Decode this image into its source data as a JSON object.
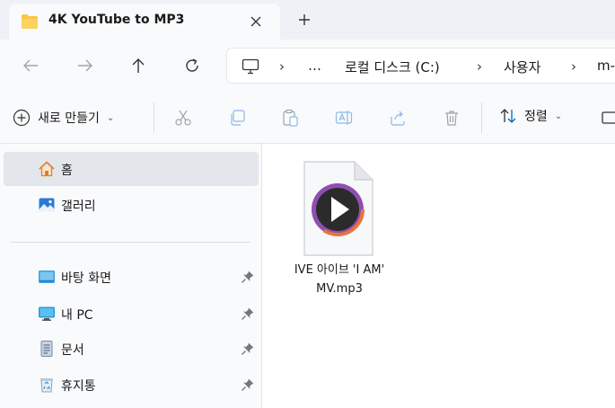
{
  "tab": {
    "title": "4K YouTube to MP3",
    "icon": "folder-icon"
  },
  "address": {
    "crumbs": [
      "…",
      "로컬 디스크 (C:)",
      "사용자",
      "m-"
    ]
  },
  "toolbar": {
    "new_label": "새로 만들기",
    "sort_label": "정렬"
  },
  "sidebar": {
    "items": [
      {
        "label": "홈",
        "icon": "home-icon",
        "selected": true
      },
      {
        "label": "갤러리",
        "icon": "gallery-icon"
      },
      {
        "label": "바탕 화면",
        "icon": "desktop-icon",
        "pinned": true
      },
      {
        "label": "내 PC",
        "icon": "pc-icon",
        "pinned": true
      },
      {
        "label": "문서",
        "icon": "document-icon",
        "pinned": true
      },
      {
        "label": "휴지통",
        "icon": "recycle-bin-icon",
        "pinned": true
      }
    ]
  },
  "files": [
    {
      "name": "IVE 아이브 'I AM' MV.mp3",
      "icon": "media-file-icon"
    }
  ],
  "colors": {
    "accent": "#0067c0",
    "folder": "#f8c644",
    "media_play": "#2b2b2b",
    "media_ring": "#e8743b"
  }
}
